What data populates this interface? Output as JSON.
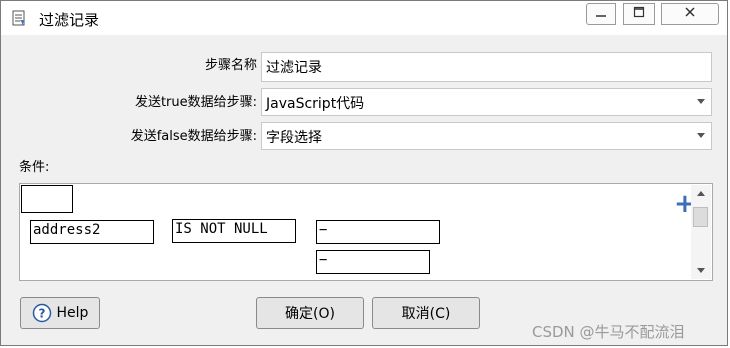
{
  "window": {
    "title": "过滤记录"
  },
  "form": {
    "step_name_label": "步骤名称",
    "step_name_value": "过滤记录",
    "true_label": "发送true数据给步骤:",
    "true_value": "JavaScript代码",
    "false_label": "发送false数据给步骤:",
    "false_value": "字段选择"
  },
  "condition": {
    "label": "条件:",
    "field": "address2",
    "operator": "IS NOT NULL",
    "value1": "−",
    "value2": "−"
  },
  "buttons": {
    "help": "Help",
    "ok": "确定(O)",
    "cancel": "取消(C)"
  },
  "watermark": "CSDN @牛马不配流泪"
}
